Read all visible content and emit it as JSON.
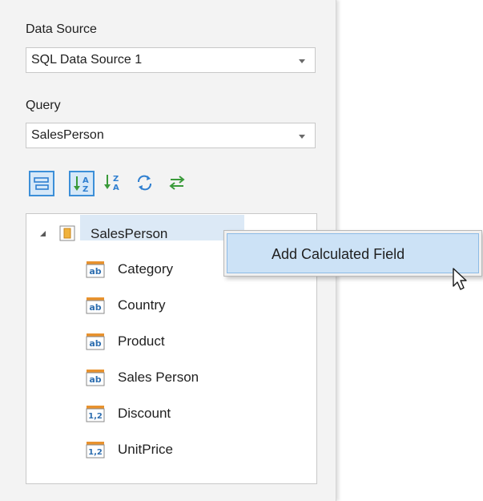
{
  "data_source": {
    "label": "Data Source",
    "value": "SQL Data Source 1"
  },
  "query": {
    "label": "Query",
    "value": "SalesPerson"
  },
  "toolbar": {
    "buttons": [
      {
        "icon": "group-fields-icon",
        "active": true
      },
      {
        "icon": "sort-ascending-icon",
        "active": true
      },
      {
        "icon": "sort-descending-icon",
        "active": false
      },
      {
        "icon": "refresh-icon",
        "active": false
      },
      {
        "icon": "swap-icon",
        "active": false
      }
    ]
  },
  "tree": {
    "root": {
      "label": "SalesPerson",
      "icon": "table-icon",
      "expanded": true
    },
    "fields": [
      {
        "label": "Category",
        "type": "ab"
      },
      {
        "label": "Country",
        "type": "ab"
      },
      {
        "label": "Product",
        "type": "ab"
      },
      {
        "label": "Sales Person",
        "type": "ab"
      },
      {
        "label": "Discount",
        "type": "1,2"
      },
      {
        "label": "UnitPrice",
        "type": "1,2"
      }
    ]
  },
  "context_menu": {
    "items": [
      {
        "label": "Add Calculated Field"
      }
    ]
  },
  "colors": {
    "panel_bg": "#f3f3f3",
    "selection_bg": "#dce9f6",
    "accent_blue": "#3c8fd8",
    "field_icon_orange": "#e8922e"
  }
}
